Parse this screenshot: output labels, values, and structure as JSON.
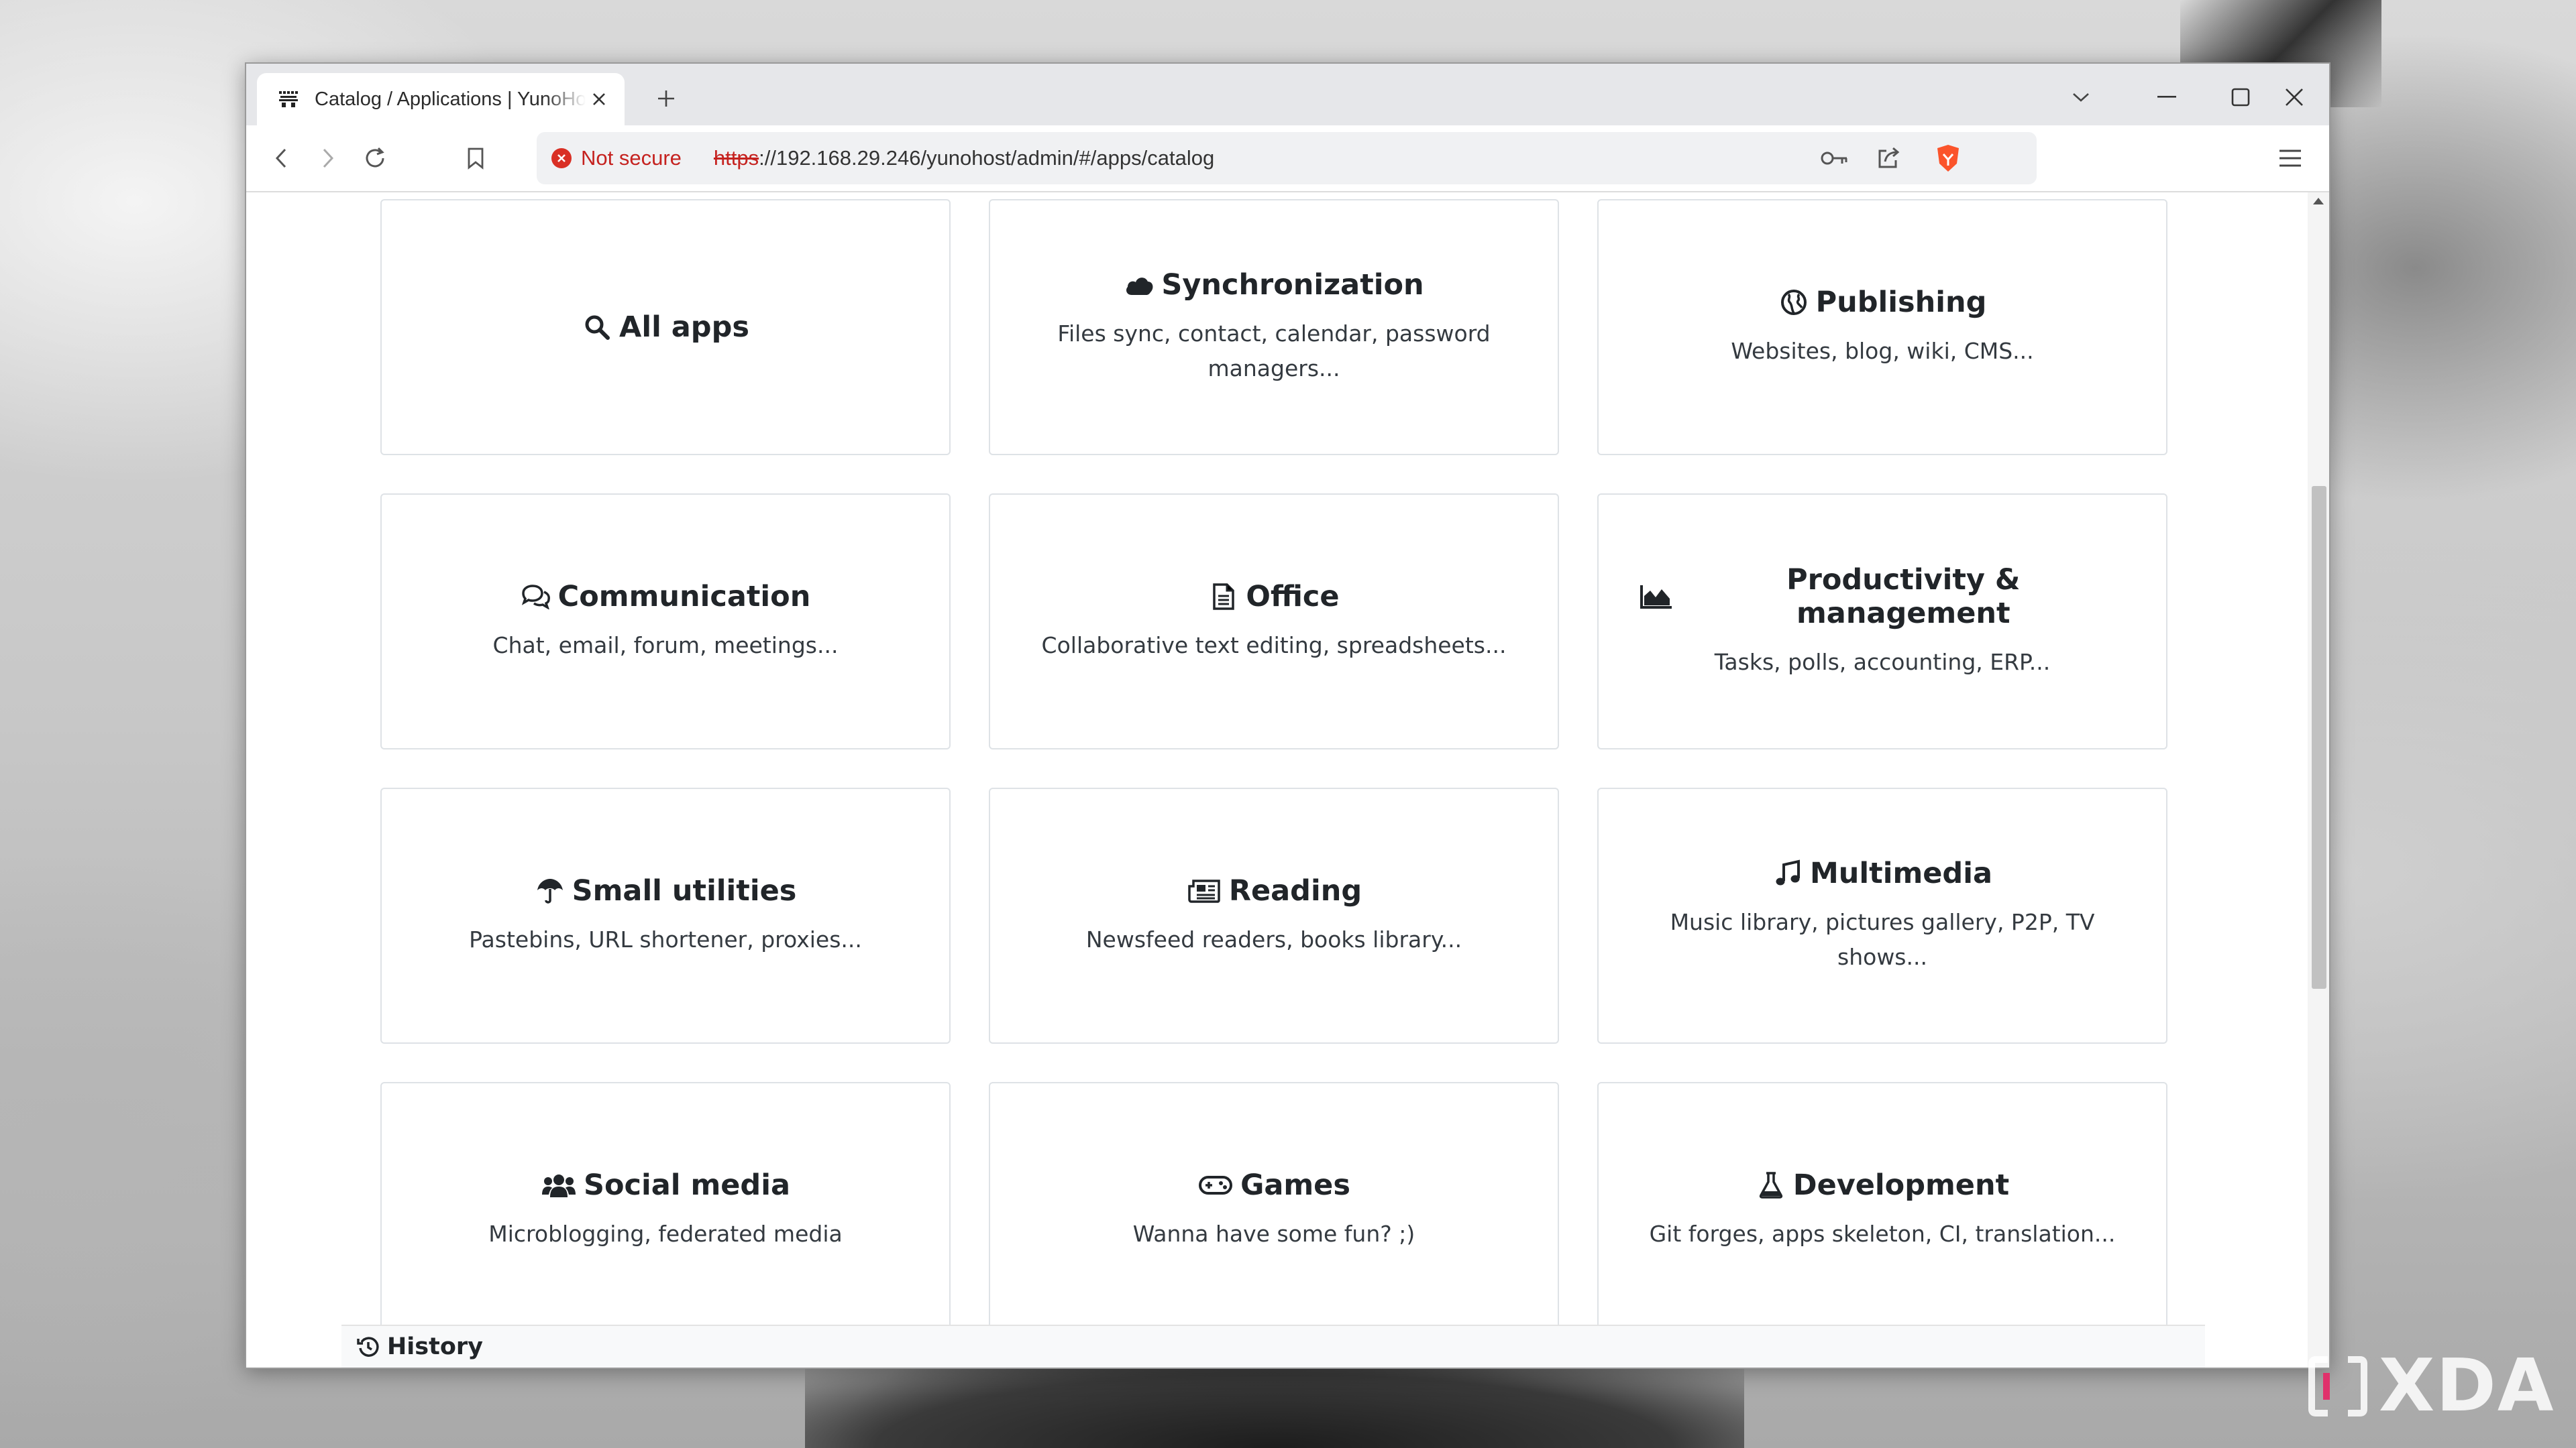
{
  "browser": {
    "tab_title": "Catalog / Applications | YunoHost",
    "security_label": "Not secure",
    "url_scheme": "https",
    "url_rest": "://192.168.29.246/yunohost/admin/#/apps/catalog"
  },
  "categories": [
    {
      "title": "All apps",
      "description": "",
      "icon": "search-icon"
    },
    {
      "title": "Synchronization",
      "description": "Files sync, contact, calendar, password managers...",
      "icon": "cloud-icon"
    },
    {
      "title": "Publishing",
      "description": "Websites, blog, wiki, CMS...",
      "icon": "globe-icon"
    },
    {
      "title": "Communication",
      "description": "Chat, email, forum, meetings...",
      "icon": "comments-icon"
    },
    {
      "title": "Office",
      "description": "Collaborative text editing, spreadsheets...",
      "icon": "file-text-icon"
    },
    {
      "title": "Productivity & management",
      "description": "Tasks, polls, accounting, ERP...",
      "icon": "area-chart-icon"
    },
    {
      "title": "Small utilities",
      "description": "Pastebins, URL shortener, proxies...",
      "icon": "umbrella-icon"
    },
    {
      "title": "Reading",
      "description": "Newsfeed readers, books library...",
      "icon": "newspaper-icon"
    },
    {
      "title": "Multimedia",
      "description": "Music library, pictures gallery, P2P, TV shows...",
      "icon": "music-icon"
    },
    {
      "title": "Social media",
      "description": "Microblogging, federated media",
      "icon": "users-icon"
    },
    {
      "title": "Games",
      "description": "Wanna have some fun? ;)",
      "icon": "gamepad-icon"
    },
    {
      "title": "Development",
      "description": "Git forges, apps skeleton, CI, translation...",
      "icon": "flask-icon"
    }
  ],
  "footer": {
    "history_label": "History"
  },
  "watermark": "XDA"
}
